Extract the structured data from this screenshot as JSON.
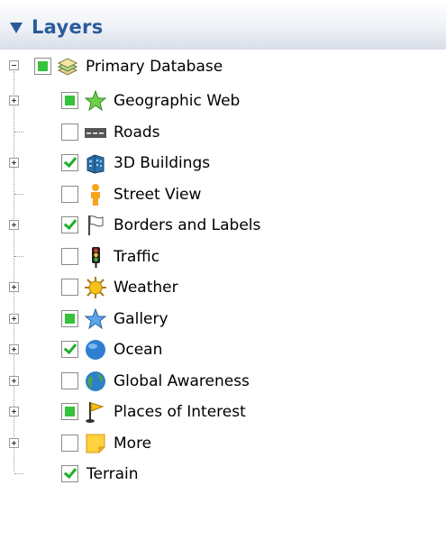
{
  "panel": {
    "title": "Layers"
  },
  "tree": {
    "root": {
      "label": "Primary Database",
      "icon": "layers-stack-icon",
      "state": "partial",
      "expanded": true
    },
    "children": [
      {
        "label": "Geographic Web",
        "icon": "green-star-icon",
        "state": "partial",
        "expandable": true
      },
      {
        "label": "Roads",
        "icon": "road-icon",
        "state": "unchecked",
        "expandable": false
      },
      {
        "label": "3D Buildings",
        "icon": "building-icon",
        "state": "checked",
        "expandable": true
      },
      {
        "label": "Street View",
        "icon": "pegman-icon",
        "state": "unchecked",
        "expandable": false
      },
      {
        "label": "Borders and Labels",
        "icon": "flag-icon",
        "state": "checked",
        "expandable": true
      },
      {
        "label": "Traffic",
        "icon": "traffic-light-icon",
        "state": "unchecked",
        "expandable": false
      },
      {
        "label": "Weather",
        "icon": "sun-icon",
        "state": "unchecked",
        "expandable": true
      },
      {
        "label": "Gallery",
        "icon": "blue-star-icon",
        "state": "partial",
        "expandable": true
      },
      {
        "label": "Ocean",
        "icon": "ocean-globe-icon",
        "state": "checked",
        "expandable": true
      },
      {
        "label": "Global Awareness",
        "icon": "earth-globe-icon",
        "state": "unchecked",
        "expandable": true
      },
      {
        "label": "Places of Interest",
        "icon": "yellow-flag-icon",
        "state": "partial",
        "expandable": true
      },
      {
        "label": "More",
        "icon": "sticky-note-icon",
        "state": "unchecked",
        "expandable": true
      },
      {
        "label": "Terrain",
        "icon": "",
        "state": "checked",
        "expandable": false
      }
    ]
  },
  "colors": {
    "accent": "#2a5b9c",
    "check_green": "#36c23a"
  }
}
